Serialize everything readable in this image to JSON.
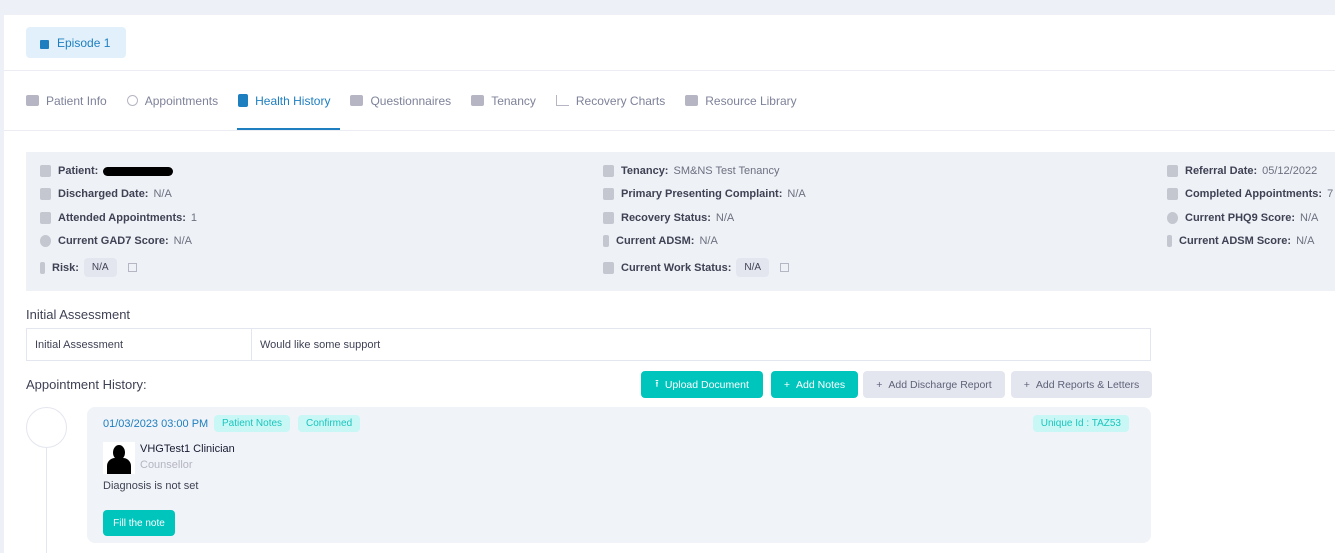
{
  "episode": {
    "label": "Episode 1",
    "icon": "unlock-icon"
  },
  "tabs": [
    {
      "label": "Patient Info",
      "icon": "id-card-icon"
    },
    {
      "label": "Appointments",
      "icon": "clock-icon"
    },
    {
      "label": "Health History",
      "icon": "file-medical-icon",
      "active": true
    },
    {
      "label": "Questionnaires",
      "icon": "chart-bar-icon"
    },
    {
      "label": "Tenancy",
      "icon": "sitemap-icon"
    },
    {
      "label": "Recovery Charts",
      "icon": "line-chart-icon"
    },
    {
      "label": "Resource Library",
      "icon": "id-card-icon"
    }
  ],
  "info": {
    "patient": {
      "label": "Patient:"
    },
    "discharged": {
      "label": "Discharged Date:",
      "value": "N/A"
    },
    "attended": {
      "label": "Attended Appointments:",
      "value": "1"
    },
    "gad7": {
      "label": "Current GAD7 Score:",
      "value": "N/A"
    },
    "risk": {
      "label": "Risk:",
      "value": "N/A"
    },
    "tenancy": {
      "label": "Tenancy:",
      "value": "SM&NS Test Tenancy"
    },
    "complaint": {
      "label": "Primary Presenting Complaint:",
      "value": "N/A"
    },
    "recovery": {
      "label": "Recovery Status:",
      "value": "N/A"
    },
    "adsm": {
      "label": "Current ADSM:",
      "value": "N/A"
    },
    "work": {
      "label": "Current Work Status:",
      "value": "N/A"
    },
    "referral": {
      "label": "Referral Date:",
      "value": "05/12/2022"
    },
    "completed": {
      "label": "Completed Appointments:",
      "value": "7"
    },
    "phq9": {
      "label": "Current PHQ9 Score:",
      "value": "N/A"
    },
    "adsm_score": {
      "label": "Current ADSM Score:",
      "value": "N/A"
    }
  },
  "initial": {
    "title": "Initial Assessment",
    "row": [
      "Initial Assessment",
      "Would like some support"
    ]
  },
  "history": {
    "title": "Appointment History:",
    "buttons": {
      "upload": "Upload Document",
      "notes": "Add Notes",
      "discharge": "Add Discharge Report",
      "reports": "Add Reports & Letters"
    },
    "item": {
      "datetime": "01/03/2023 03:00 PM",
      "type": "Patient Notes",
      "status": "Confirmed",
      "unique_id": "Unique Id : TAZ53",
      "clinician": "VHGTest1 Clinician",
      "role": "Counsellor",
      "diagnosis": "Diagnosis is not set",
      "action": "Fill the note"
    }
  },
  "colors": {
    "accent": "#1e7fc0",
    "teal": "#00c5bd"
  }
}
